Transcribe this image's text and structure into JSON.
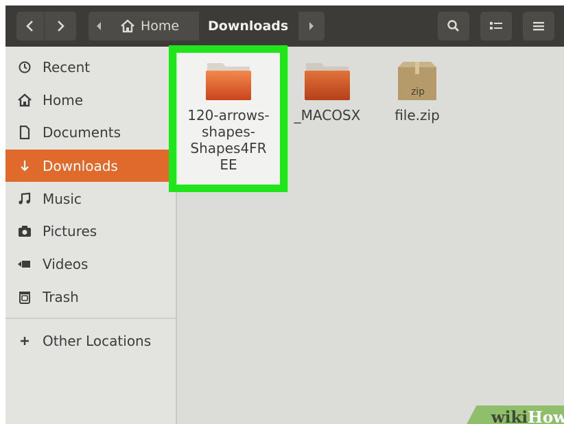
{
  "toolbar": {
    "back_icon": "chevron-left-icon",
    "forward_icon": "chevron-right-icon",
    "search_icon": "search-icon",
    "view_toggle_icon": "list-view-icon",
    "menu_icon": "hamburger-menu-icon"
  },
  "breadcrumb": {
    "home": "Home",
    "current": "Downloads"
  },
  "sidebar": {
    "items": [
      {
        "label": "Recent",
        "icon": "clock-icon"
      },
      {
        "label": "Home",
        "icon": "home-icon"
      },
      {
        "label": "Documents",
        "icon": "document-icon"
      },
      {
        "label": "Downloads",
        "icon": "download-icon",
        "active": true
      },
      {
        "label": "Music",
        "icon": "music-icon"
      },
      {
        "label": "Pictures",
        "icon": "camera-icon"
      },
      {
        "label": "Videos",
        "icon": "video-icon"
      },
      {
        "label": "Trash",
        "icon": "trash-icon"
      }
    ],
    "other_locations": "Other Locations"
  },
  "files": [
    {
      "name_lines": [
        "120-arrows-",
        "shapes-",
        "Shapes4FR",
        "EE"
      ],
      "type": "folder",
      "selected": true
    },
    {
      "name": "_MACOSX",
      "type": "folder"
    },
    {
      "name": "file.zip",
      "type": "zip",
      "badge": "zip"
    }
  ],
  "watermark": {
    "wiki": "wiki",
    "how": "How"
  },
  "colors": {
    "accent": "#e06a2c",
    "highlight": "#22e41c",
    "headerbar": "#3c3b37"
  }
}
